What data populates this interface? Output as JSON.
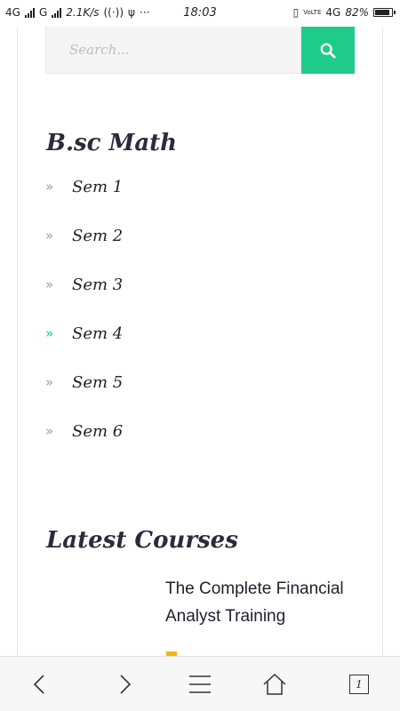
{
  "status_bar": {
    "network_1": "4G",
    "network_2": "G",
    "speed": "2.1K/s",
    "more": "···",
    "time": "18:03",
    "volte": "VoLTE",
    "network_3": "4G",
    "battery": "82%"
  },
  "search": {
    "placeholder": "Search..."
  },
  "category_widget": {
    "title": "B.sc Math",
    "items": [
      {
        "label": "Sem 1",
        "active": false
      },
      {
        "label": "Sem 2",
        "active": false
      },
      {
        "label": "Sem 3",
        "active": false
      },
      {
        "label": "Sem 4",
        "active": true
      },
      {
        "label": "Sem 5",
        "active": false
      },
      {
        "label": "Sem 6",
        "active": false
      }
    ],
    "arrow_glyph": "»"
  },
  "courses_widget": {
    "title": "Latest Courses",
    "course_title": "The Complete Financial Analyst Training"
  },
  "browser_nav": {
    "tab_count": "1"
  },
  "colors": {
    "accent": "#1fcb89",
    "price": "#f2b61b",
    "heading": "#2b2b3a"
  }
}
